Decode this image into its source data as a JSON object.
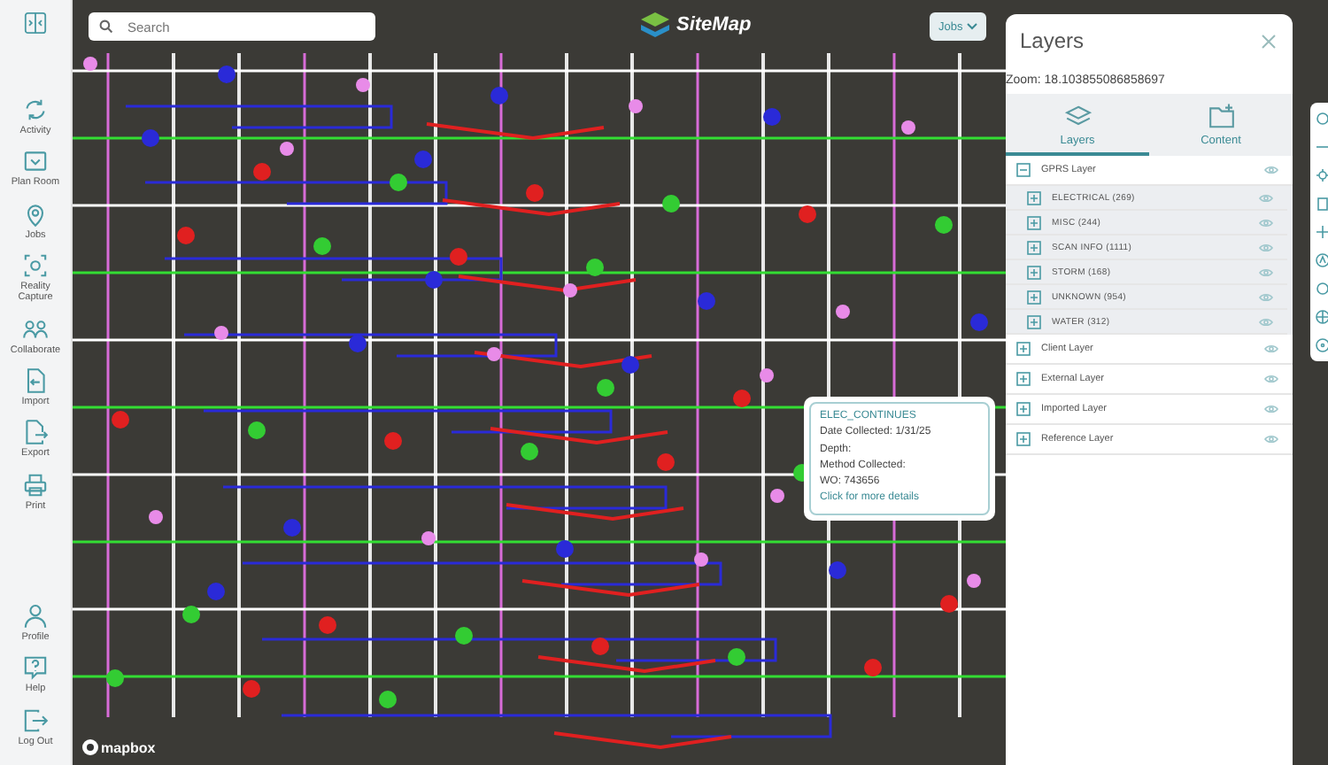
{
  "sidebar": {
    "items": [
      {
        "label": "Activity"
      },
      {
        "label": "Plan Room"
      },
      {
        "label": "Jobs"
      },
      {
        "label": "Reality Capture"
      },
      {
        "label": "Collaborate"
      },
      {
        "label": "Import"
      },
      {
        "label": "Export"
      },
      {
        "label": "Print"
      }
    ],
    "bottom_items": [
      {
        "label": "Profile"
      },
      {
        "label": "Help"
      },
      {
        "label": "Log Out"
      }
    ]
  },
  "search": {
    "placeholder": "Search"
  },
  "logo": {
    "text": "SiteMap"
  },
  "jobs_button": {
    "label": "Jobs"
  },
  "popup": {
    "title": "ELEC_CONTINUES",
    "lines": [
      "Date Collected: 1/31/25",
      "Depth:",
      "Method Collected:",
      "WO: 743656"
    ],
    "link": "Click for more details"
  },
  "attribution": {
    "text": "mapbox"
  },
  "layers_panel": {
    "title": "Layers",
    "zoom": "Zoom: 18.103855086858697",
    "tabs": [
      {
        "label": "Layers",
        "selected": true
      },
      {
        "label": "Content",
        "selected": false
      }
    ],
    "tree": [
      {
        "label": "GPRS Layer",
        "expanded": true,
        "children": [
          {
            "label": "ELECTRICAL (269)",
            "expanded": false
          },
          {
            "label": "MISC (244)",
            "expanded": false
          },
          {
            "label": "SCAN INFO (1111)",
            "expanded": false
          },
          {
            "label": "STORM (168)",
            "expanded": false
          },
          {
            "label": "UNKNOWN (954)",
            "expanded": false
          },
          {
            "label": "WATER (312)",
            "expanded": false
          }
        ]
      },
      {
        "label": "Client Layer",
        "expanded": false
      },
      {
        "label": "External Layer",
        "expanded": false
      },
      {
        "label": "Imported Layer",
        "expanded": false
      },
      {
        "label": "Reference Layer",
        "expanded": false
      }
    ]
  }
}
